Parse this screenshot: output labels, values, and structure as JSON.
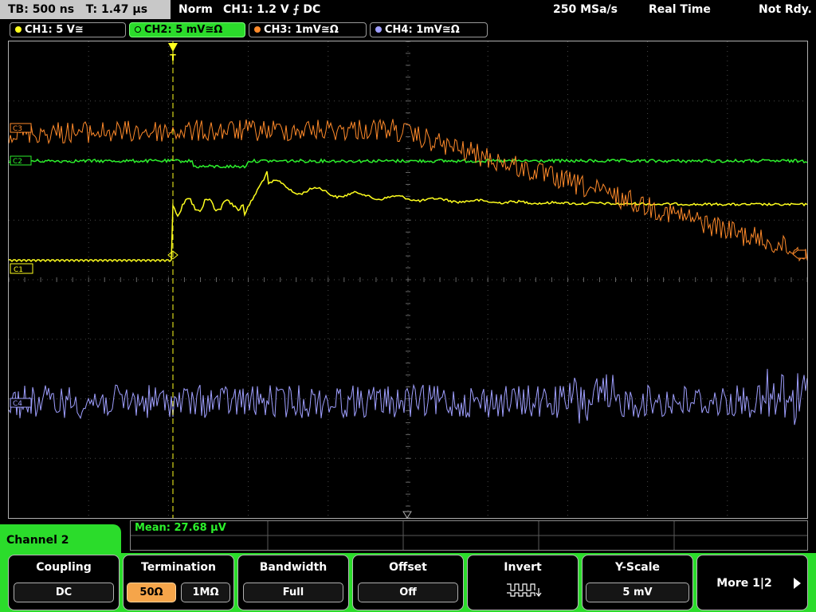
{
  "status": {
    "timebase": "TB: 500 ns",
    "trigger_time": "T: 1.47 µs",
    "trigger_mode": "Norm",
    "trigger_source": "CH1: 1.2 V ⨍ DC",
    "sample_rate": "250 MSa/s",
    "acq_mode": "Real Time",
    "trigger_state": "Not Rdy."
  },
  "channels": [
    {
      "label": "CH1: 5 V≅",
      "color": "#ffff1e"
    },
    {
      "label": "CH2: 5 mV≅Ω",
      "color": "#2cf02c"
    },
    {
      "label": "CH3: 1mV≅Ω",
      "color": "#ff8a2a"
    },
    {
      "label": "CH4: 1mV≅Ω",
      "color": "#9f9fff"
    }
  ],
  "markers": {
    "ch1": "C1",
    "ch2": "C2",
    "ch3": "C3",
    "ch4": "C4",
    "trigger": "T"
  },
  "measurement": {
    "text": "Mean: 27.68 µV"
  },
  "menu": {
    "title": "Channel 2"
  },
  "softkeys": {
    "coupling": {
      "label": "Coupling",
      "value": "DC"
    },
    "termination": {
      "label": "Termination",
      "options": [
        "50Ω",
        "1MΩ"
      ],
      "selected": "50Ω"
    },
    "bandwidth": {
      "label": "Bandwidth",
      "value": "Full"
    },
    "offset": {
      "label": "Offset",
      "value": "Off"
    },
    "invert": {
      "label": "Invert",
      "icon": "invert-pulse-icon"
    },
    "yscale": {
      "label": "Y-Scale",
      "value": "5 mV"
    },
    "more": {
      "label": "More 1|2",
      "icon": "right-arrow-icon"
    }
  },
  "colors": {
    "accent": "#2bdc2b",
    "grid": "#4a4a4a",
    "selected_option": "#f5a54a"
  }
}
